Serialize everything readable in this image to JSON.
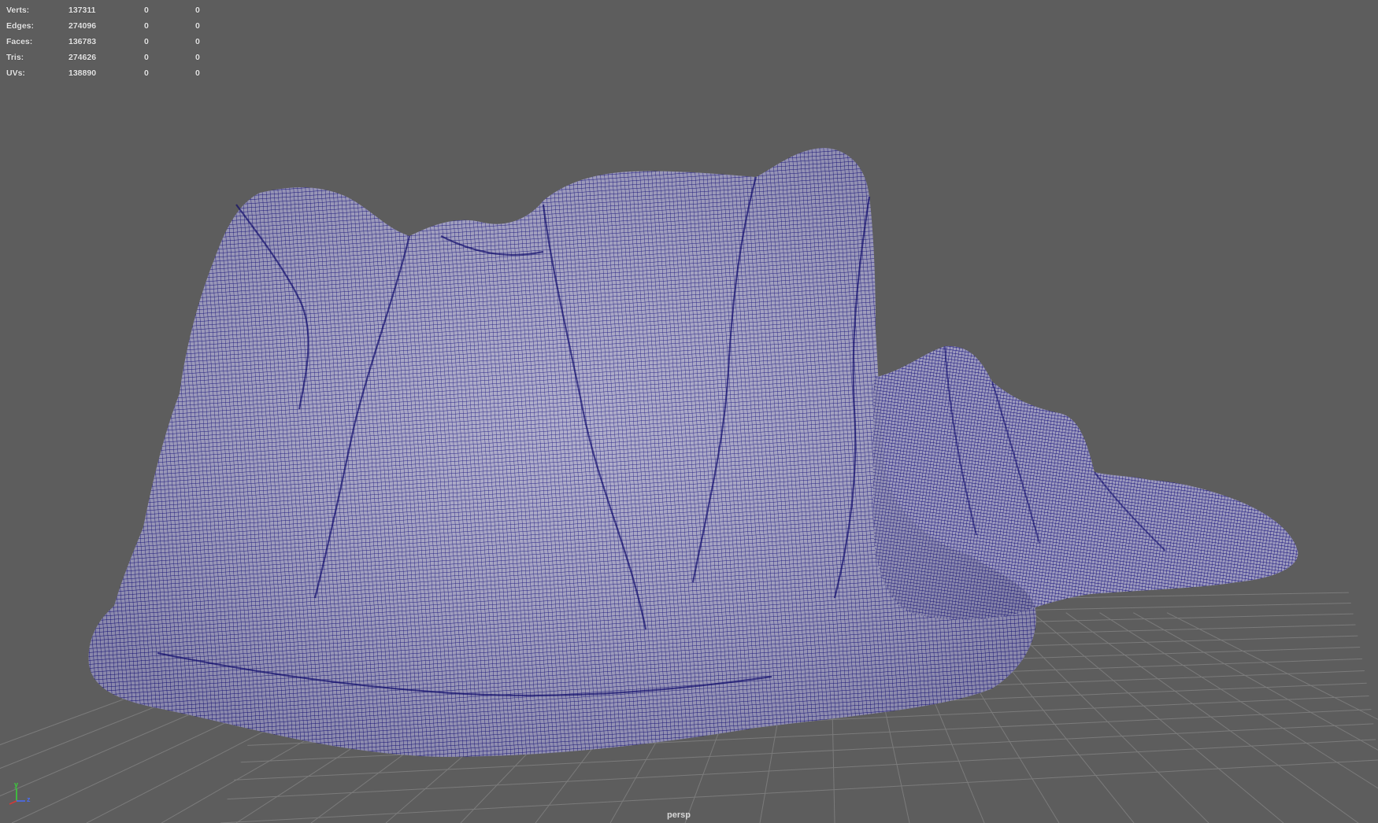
{
  "viewport": {
    "camera": "persp"
  },
  "stats": {
    "rows": [
      {
        "label": "Verts:",
        "total": "137311",
        "selected": "0",
        "component": "0"
      },
      {
        "label": "Edges:",
        "total": "274096",
        "selected": "0",
        "component": "0"
      },
      {
        "label": "Faces:",
        "total": "136783",
        "selected": "0",
        "component": "0"
      },
      {
        "label": "Tris:",
        "total": "274626",
        "selected": "0",
        "component": "0"
      },
      {
        "label": "UVs:",
        "total": "138890",
        "selected": "0",
        "component": "0"
      }
    ]
  },
  "axis_gizmo": {
    "y": "y",
    "z": "z",
    "x_color": "#d13a3a",
    "y_color": "#3ad13a",
    "z_color": "#4a6cf0"
  },
  "colors": {
    "background": "#5d5d5d",
    "grid": "#7a7a7a",
    "mesh_fill": "#a6a4c4",
    "wire": "#0e0a7a"
  }
}
